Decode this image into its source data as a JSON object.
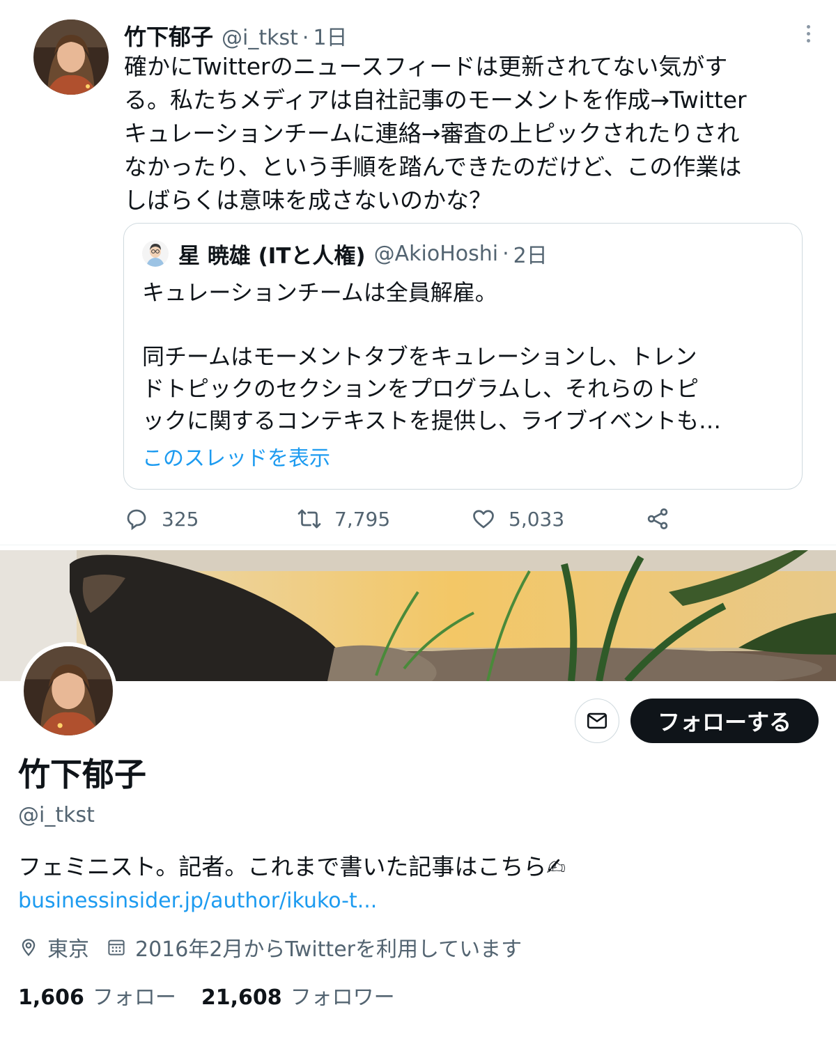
{
  "tweet": {
    "author_name": "竹下郁子",
    "author_handle": "@i_tkst",
    "separator": "·",
    "time": "1日",
    "text": "確かにTwitterのニュースフィードは更新されてない気がす\nる。私たちメディアは自社記事のモーメントを作成→Twitter\nキュレーションチームに連絡→審査の上ピックされたりされ\nなかったり、という手順を踏んできたのだけど、この作業は\nしばらくは意味を成さないのかな？",
    "quote": {
      "author_name": "星 暁雄 (ITと人権)",
      "author_handle": "@AkioHoshi",
      "separator": "·",
      "time": "2日",
      "text": "キュレーションチームは全員解雇。\n\n同チームはモーメントタブをキュレーションし、トレン\nドトピックのセクションをプログラムし、それらのトピ\nックに関するコンテキストを提供し、ライブイベントも…",
      "show_thread": "このスレッドを表示"
    },
    "actions": {
      "replies": "325",
      "retweets": "7,795",
      "likes": "5,033"
    }
  },
  "profile": {
    "name": "竹下郁子",
    "handle": "@i_tkst",
    "follow_label": "フォローする",
    "bio": "フェミニスト。記者。これまで書いた記事はこちら✍",
    "link": "businessinsider.jp/author/ikuko-t...",
    "location": "東京",
    "joined": "2016年2月からTwitterを利用しています",
    "following_count": "1,606",
    "following_label": "フォロー",
    "followers_count": "21,608",
    "followers_label": "フォロワー"
  },
  "icons": {
    "more": "more-vertical-icon",
    "reply": "reply-icon",
    "retweet": "retweet-icon",
    "like": "heart-icon",
    "share": "share-icon",
    "message": "mail-icon",
    "location": "location-icon",
    "calendar": "calendar-icon"
  },
  "colors": {
    "link": "#1d9bf0",
    "secondary_text": "#536471",
    "primary_text": "#0f1419",
    "follow_button_bg": "#0f1419"
  }
}
